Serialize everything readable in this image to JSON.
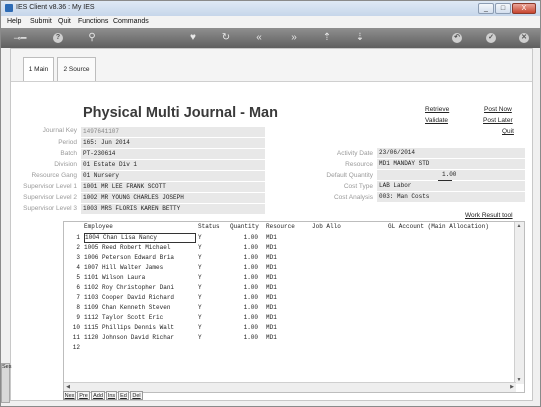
{
  "window": {
    "title": "IES Client v8.36 : My IES",
    "controls": [
      "_",
      "□",
      "X"
    ]
  },
  "menu": [
    "Help",
    "Submit",
    "Quit",
    "Functions",
    "Commands"
  ],
  "toolbar_icons": [
    "key-icon",
    "help-icon",
    "search-icon",
    "heart-icon",
    "refresh-icon",
    "rewind-icon",
    "fast-forward-icon",
    "upload-icon",
    "download-icon",
    "back-icon",
    "check-icon",
    "close-icon"
  ],
  "tabs": [
    {
      "label": "1 Main",
      "active": true
    },
    {
      "label": "2 Source",
      "active": false
    }
  ],
  "page_title": "Physical Multi Journal - Man",
  "links": {
    "retrieve": "Retrieve",
    "validate": "Validate",
    "post_now": "Post Now",
    "post_later": "Post Later",
    "quit": "Quit",
    "work_result_tool": "Work Result tool"
  },
  "fields_left": [
    {
      "label": "Journal Key",
      "value": "1497641107"
    },
    {
      "label": "Period",
      "value": "165: Jun 2014"
    },
    {
      "label": "Batch",
      "value": "PT-230614"
    },
    {
      "label": "Division",
      "value": "01 Estate Div 1"
    },
    {
      "label": "Resource Gang",
      "value": "01 Nursery"
    },
    {
      "label": "Supervisor Level 1",
      "value": "1001 MR LEE FRANK SCOTT"
    },
    {
      "label": "Supervisor Level 2",
      "value": "1002 MR YOUNG CHARLES JOSEPH"
    },
    {
      "label": "Supervisor Level 3",
      "value": "1003 MRS FLORIS KAREN BETTY"
    }
  ],
  "fields_right": [
    {
      "label": "Activity Date",
      "value": "23/06/2014"
    },
    {
      "label": "Resource",
      "value": "MD1 MANDAY STD"
    },
    {
      "label": "Default Quantity",
      "value": "1.00"
    },
    {
      "label": "Cost Type",
      "value": "LAB Labor"
    },
    {
      "label": "Cost Analysis",
      "value": "003: Man Costs"
    }
  ],
  "grid": {
    "headers": [
      "Employee",
      "Status",
      "Quantity",
      "Resource",
      "Job Allo",
      "GL Account (Main Allocation)"
    ],
    "rows": [
      {
        "n": "1",
        "employee": "1004 Chan Lisa Nancy",
        "status": "Y",
        "qty": "1.00",
        "res": "MD1"
      },
      {
        "n": "2",
        "employee": "1005 Reed Robert Michael",
        "status": "Y",
        "qty": "1.00",
        "res": "MD1"
      },
      {
        "n": "3",
        "employee": "1006 Peterson Edward Bria",
        "status": "Y",
        "qty": "1.00",
        "res": "MD1"
      },
      {
        "n": "4",
        "employee": "1007 Hill Walter James",
        "status": "Y",
        "qty": "1.00",
        "res": "MD1"
      },
      {
        "n": "5",
        "employee": "1101 Wilson Laura",
        "status": "Y",
        "qty": "1.00",
        "res": "MD1"
      },
      {
        "n": "6",
        "employee": "1102 Roy Christopher Dani",
        "status": "Y",
        "qty": "1.00",
        "res": "MD1"
      },
      {
        "n": "7",
        "employee": "1103 Cooper David Richard",
        "status": "Y",
        "qty": "1.00",
        "res": "MD1"
      },
      {
        "n": "8",
        "employee": "1109 Chan Kenneth Steven",
        "status": "Y",
        "qty": "1.00",
        "res": "MD1"
      },
      {
        "n": "9",
        "employee": "1112 Taylor Scott Eric",
        "status": "Y",
        "qty": "1.00",
        "res": "MD1"
      },
      {
        "n": "10",
        "employee": "1115 Phillips Dennis Walt",
        "status": "Y",
        "qty": "1.00",
        "res": "MD1"
      },
      {
        "n": "11",
        "employee": "1120 Johnson David Richar",
        "status": "Y",
        "qty": "1.00",
        "res": "MD1"
      },
      {
        "n": "12",
        "employee": "",
        "status": "",
        "qty": "",
        "res": ""
      }
    ]
  },
  "bottom_buttons": [
    "Nex",
    "Pre",
    "Add",
    "Ins",
    "Ed",
    "Del"
  ],
  "side_panel_label": "Ses"
}
